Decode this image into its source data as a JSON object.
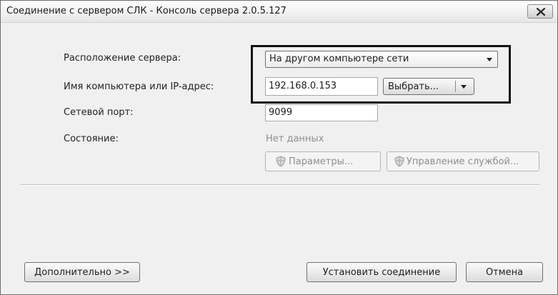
{
  "window": {
    "title": "Соединение с сервером СЛК - Консоль сервера 2.0.5.127"
  },
  "form": {
    "location_label": "Расположение сервера:",
    "location_value": "На другом компьютере сети",
    "host_label": "Имя компьютера или IP-адрес:",
    "host_value": "192.168.0.153",
    "select_button": "Выбрать...",
    "port_label": "Сетевой порт:",
    "port_value": "9099",
    "status_label": "Состояние:",
    "status_value": "Нет данных",
    "params_button": "Параметры...",
    "service_button": "Управление службой..."
  },
  "footer": {
    "more_button": "Дополнительно >>",
    "connect_button": "Установить соединение",
    "cancel_button": "Отмена"
  },
  "icons": {
    "close": "close-icon",
    "dropdown": "chevron-down-icon",
    "shield": "shield-icon"
  },
  "colors": {
    "window_bg": "#f0f0f0",
    "highlight_border": "#111111",
    "disabled_text": "#8d8d8d"
  }
}
